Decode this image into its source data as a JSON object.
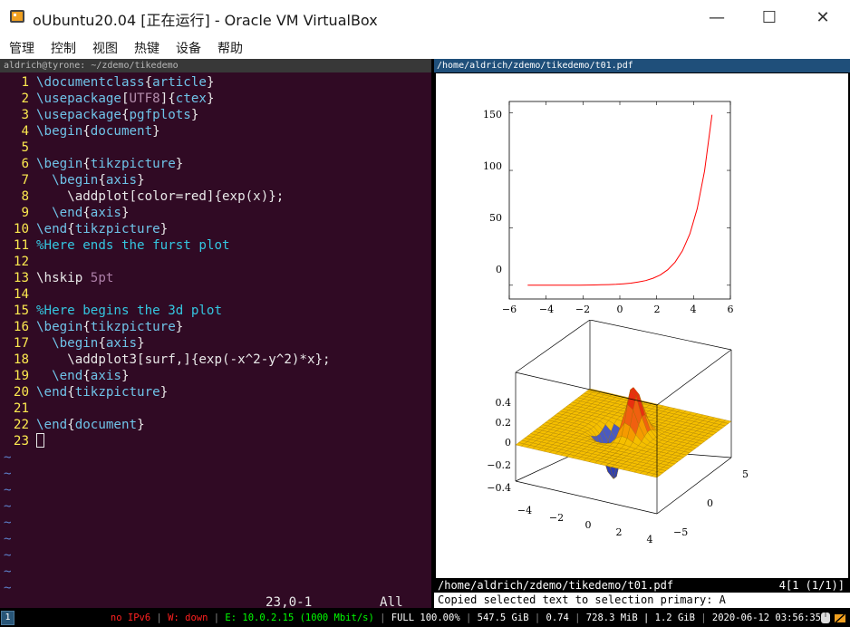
{
  "window": {
    "title": "oUbuntu20.04 [正在运行] - Oracle VM VirtualBox",
    "minimize_glyph": "—",
    "maximize_glyph": "☐",
    "close_glyph": "✕"
  },
  "menu": [
    "管理",
    "控制",
    "视图",
    "热键",
    "设备",
    "帮助"
  ],
  "terminal": {
    "title": "aldrich@tyrone: ~/zdemo/tikedemo",
    "line_numbers": [
      "1",
      "2",
      "3",
      "4",
      "5",
      "6",
      "7",
      "8",
      "9",
      "10",
      "11",
      "12",
      "13",
      "14",
      "15",
      "16",
      "17",
      "18",
      "19",
      "20",
      "21",
      "22",
      "23"
    ],
    "ruler_pos": "23,0-1",
    "ruler_pct": "All",
    "tilde": "~"
  },
  "code": {
    "l1": [
      "\\documentclass",
      "{",
      "article",
      "}"
    ],
    "l2": [
      "\\usepackage",
      "[",
      "UTF8",
      "]{",
      "ctex",
      "}"
    ],
    "l3": [
      "\\usepackage",
      "{",
      "pgfplots",
      "}"
    ],
    "l4": [
      "\\begin",
      "{",
      "document",
      "}"
    ],
    "l6": [
      "\\begin",
      "{",
      "tikzpicture",
      "}"
    ],
    "l7": [
      "  \\begin",
      "{",
      "axis",
      "}"
    ],
    "l8": [
      "    \\addplot",
      "[color=red]{exp(x)};"
    ],
    "l9": [
      "  \\end",
      "{",
      "axis",
      "}"
    ],
    "l10": [
      "\\end",
      "{",
      "tikzpicture",
      "}"
    ],
    "l11": "%Here ends the furst plot",
    "l13": [
      "\\hskip ",
      "5pt"
    ],
    "l15": "%Here begins the 3d plot",
    "l16": [
      "\\begin",
      "{",
      "tikzpicture",
      "}"
    ],
    "l17": [
      "  \\begin",
      "{",
      "axis",
      "}"
    ],
    "l18": [
      "    \\addplot3",
      "[surf,]{exp(-x^2-y^2)*x};"
    ],
    "l19": [
      "  \\end",
      "{",
      "axis",
      "}"
    ],
    "l20": [
      "\\end",
      "{",
      "tikzpicture",
      "}"
    ],
    "l22": [
      "\\end",
      "{",
      "document",
      "}"
    ]
  },
  "pdf": {
    "title": "/home/aldrich/zdemo/tikedemo/t01.pdf",
    "status_path": "/home/aldrich/zdemo/tikedemo/t01.pdf",
    "status_page": "4[1 (1/1)]",
    "message": "Copied selected text to selection primary: A"
  },
  "chart_data": [
    {
      "type": "line",
      "function": "exp(x)",
      "x": [
        -5,
        -4,
        -3,
        -2,
        -1,
        0,
        1,
        2,
        3,
        4,
        5
      ],
      "y": [
        0.0067,
        0.0183,
        0.0498,
        0.135,
        0.368,
        1,
        2.718,
        7.389,
        20.09,
        54.6,
        148.4
      ],
      "xlim": [
        -6,
        6
      ],
      "ylim": [
        -12,
        160
      ],
      "xticks": [
        "−6",
        "−4",
        "−2",
        "0",
        "2",
        "4",
        "6"
      ],
      "yticks": [
        "0",
        "50",
        "100",
        "150"
      ],
      "color": "#ff0000"
    },
    {
      "type": "surface",
      "function": "exp(-x^2-y^2)*x",
      "x_range": [
        -5,
        5
      ],
      "y_range": [
        -5,
        5
      ],
      "zlim": [
        -0.43,
        0.43
      ],
      "xticks": [
        "−4",
        "−2",
        "0",
        "2",
        "4"
      ],
      "yticks": [
        "−5",
        "0",
        "5"
      ],
      "zticks": [
        "0.4",
        "0.2",
        "0",
        "−0.2",
        "−0.4"
      ],
      "colors": {
        "surface": "#f5bf00",
        "peak": "#e83010",
        "trough": "#2f3fb0",
        "mesh": "#9a7000"
      }
    }
  ],
  "statusbar": {
    "workspace": "1",
    "ipv6": "no IPv6",
    "wireless": "W: down",
    "ethernet": "E: 10.0.2.15 (1000 Mbit/s)",
    "battery": "FULL 100.00%",
    "disk": "547.5 GiB",
    "load": "0.74",
    "memory": "728.3 MiB | 1.2 GiB",
    "datetime": "2020-06-12 03:56:35",
    "sep": "|"
  }
}
